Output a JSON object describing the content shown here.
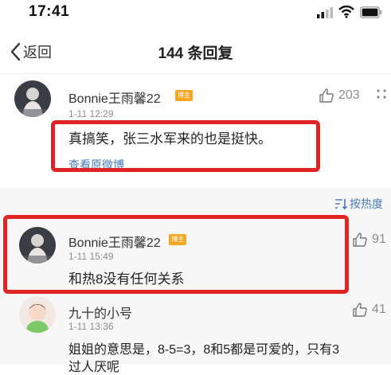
{
  "status_bar": {
    "time": "17:41"
  },
  "nav": {
    "back_label": "返回",
    "title": "144 条回复"
  },
  "main_comment": {
    "username": "Bonnie王雨馨22",
    "badge": "博主",
    "time": "1-11 12:29",
    "text": "真搞笑，张三水军来的也是挺快。",
    "link": "查看原微博",
    "likes": "203"
  },
  "sort": {
    "label": "按热度"
  },
  "replies": [
    {
      "username": "Bonnie王雨馨22",
      "badge": "博主",
      "time": "1-11 15:49",
      "text": "和热8没有任何关系",
      "likes": "91"
    },
    {
      "username": "九十的小号",
      "time": "1-11 13:36",
      "text_line1": "姐姐的意思是，8-5=3，8和5都是可爱的，只有3",
      "text_line2": "过人厌呢",
      "likes": "41"
    }
  ],
  "colors": {
    "highlight": "#e02424",
    "link": "#4a7ab8",
    "badge": "#f5a623"
  }
}
